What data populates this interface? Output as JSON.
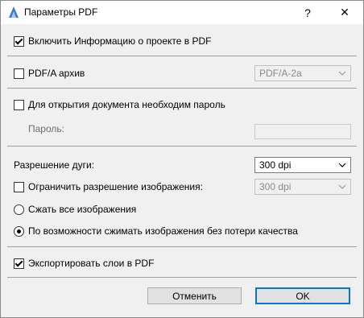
{
  "window": {
    "title": "Параметры PDF",
    "help_glyph": "?",
    "close_glyph": "✕"
  },
  "options": {
    "project_info": {
      "label": "Включить Информацию о проекте в PDF",
      "checked": true
    },
    "pdfa_archive": {
      "label": "PDF/A архив",
      "checked": false,
      "select_value": "PDF/A-2a"
    },
    "password_required": {
      "label": "Для открытия документа необходим пароль",
      "checked": false
    },
    "password": {
      "label": "Пароль:",
      "value": ""
    },
    "arc_resolution": {
      "label": "Разрешение дуги:",
      "select_value": "300 dpi"
    },
    "limit_image_resolution": {
      "label": "Ограничить разрешение изображения:",
      "checked": false,
      "select_value": "300 dpi"
    },
    "compress_all": {
      "label": "Сжать все изображения",
      "selected": false
    },
    "lossless_compress": {
      "label": "По возможности сжимать изображения без потери качества",
      "selected": true
    },
    "export_layers": {
      "label": "Экспортировать слои в PDF",
      "checked": true
    }
  },
  "buttons": {
    "cancel": "Отменить",
    "ok": "OK"
  },
  "icons": {
    "app": "archicad-icon",
    "dropdown": "chevron-down-icon"
  }
}
